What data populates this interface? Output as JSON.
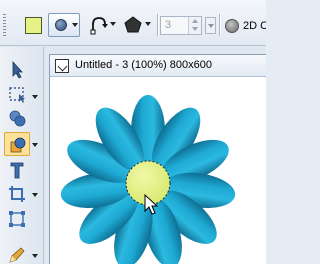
{
  "toolbar": {
    "fill_color": "#e6f285",
    "shape_tool_icon": "ellipse-shape-icon",
    "curve_tool_icon": "curve-arrow-icon",
    "polygon_tool_icon": "pentagon-icon",
    "sides_value": "3",
    "mode_icon": "sphere-icon",
    "mode_label": "2D C"
  },
  "toolbox": {
    "tools": [
      {
        "icon": "pointer-arrow-icon"
      },
      {
        "icon": "marquee-select-icon"
      },
      {
        "icon": "blob-shapes-icon"
      },
      {
        "icon": "shape-fill-icon",
        "active": true
      },
      {
        "icon": "text-tool-icon"
      },
      {
        "icon": "crop-tool-icon"
      },
      {
        "icon": "transform-tool-icon"
      },
      {
        "icon": "pen-tool-icon"
      }
    ]
  },
  "document": {
    "title": "Untitled - 3 (100%) 800x600",
    "petal_color": "#1aa8d0",
    "center_color": "#e6f285"
  }
}
